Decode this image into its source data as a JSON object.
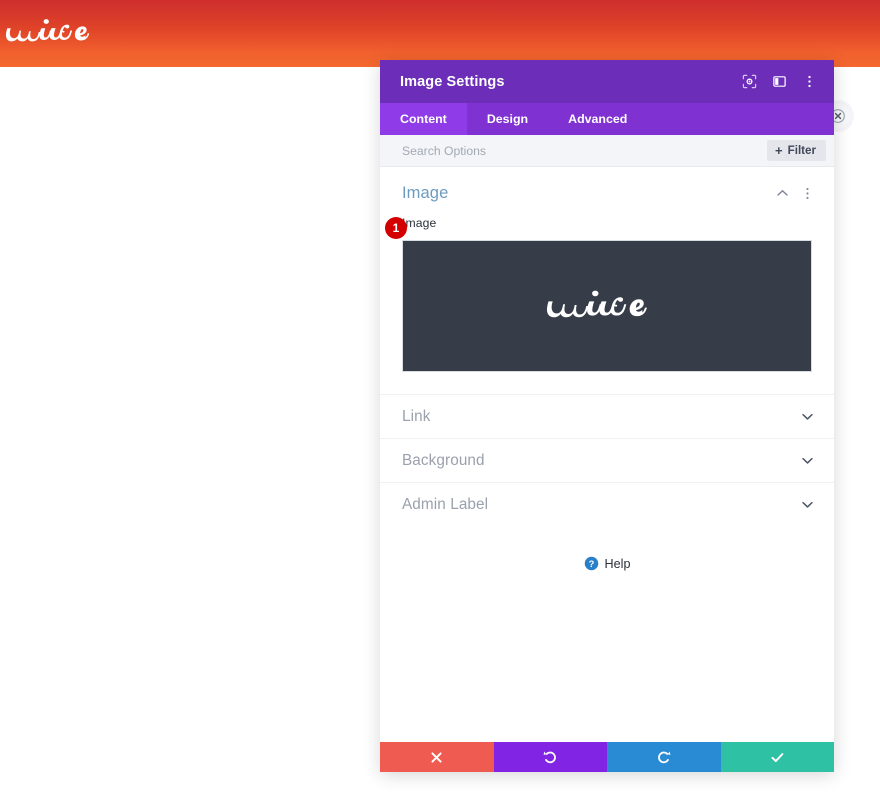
{
  "site": {
    "logo_icon": "wire-script-logo",
    "logo_text": "wire",
    "gradient_top": "#cf2e2e",
    "gradient_bottom": "#f4682f"
  },
  "close_badge": {
    "icon": "close-circle-icon",
    "tooltip": "Close"
  },
  "modal": {
    "title": "Image Settings",
    "accent_color": "#6c2eb9",
    "titlebar_actions": [
      {
        "name": "expand-icon",
        "label": "Expand"
      },
      {
        "name": "layout-toggle-icon",
        "label": "Change modal position"
      },
      {
        "name": "more-options-icon",
        "label": "More options"
      }
    ],
    "tabs": [
      {
        "label": "Content",
        "active": true
      },
      {
        "label": "Design",
        "active": false
      },
      {
        "label": "Advanced",
        "active": false
      }
    ],
    "search": {
      "placeholder": "Search Options",
      "value": ""
    },
    "filter": {
      "label": "Filter",
      "plus": "+"
    },
    "sections": [
      {
        "title": "Image",
        "open": true,
        "collapse_icon": "chevron-up-icon",
        "menu_icon": "section-more-icon",
        "field": {
          "label": "Image",
          "step_badge": "1",
          "step_badge_color": "#d40000",
          "preview": {
            "background": "#363d48",
            "logo_icon": "wire-script-logo",
            "logo_text": "wire"
          }
        }
      }
    ],
    "collapsed_sections": [
      {
        "label": "Link",
        "icon": "chevron-down-icon"
      },
      {
        "label": "Background",
        "icon": "chevron-down-icon"
      },
      {
        "label": "Admin Label",
        "icon": "chevron-down-icon"
      }
    ],
    "help": {
      "label": "Help",
      "icon": "question-circle-icon",
      "icon_color": "#2a7fc9"
    },
    "footer_buttons": [
      {
        "name": "cancel-button",
        "icon": "close-x-icon",
        "color": "#ef5b50",
        "label": "Discard changes"
      },
      {
        "name": "undo-button",
        "icon": "undo-arrow-icon",
        "color": "#8224e3",
        "label": "Undo"
      },
      {
        "name": "redo-button",
        "icon": "redo-arrow-icon",
        "color": "#2a8bd5",
        "label": "Redo"
      },
      {
        "name": "save-button",
        "icon": "checkmark-icon",
        "color": "#2ec1a4",
        "label": "Save changes"
      }
    ]
  }
}
